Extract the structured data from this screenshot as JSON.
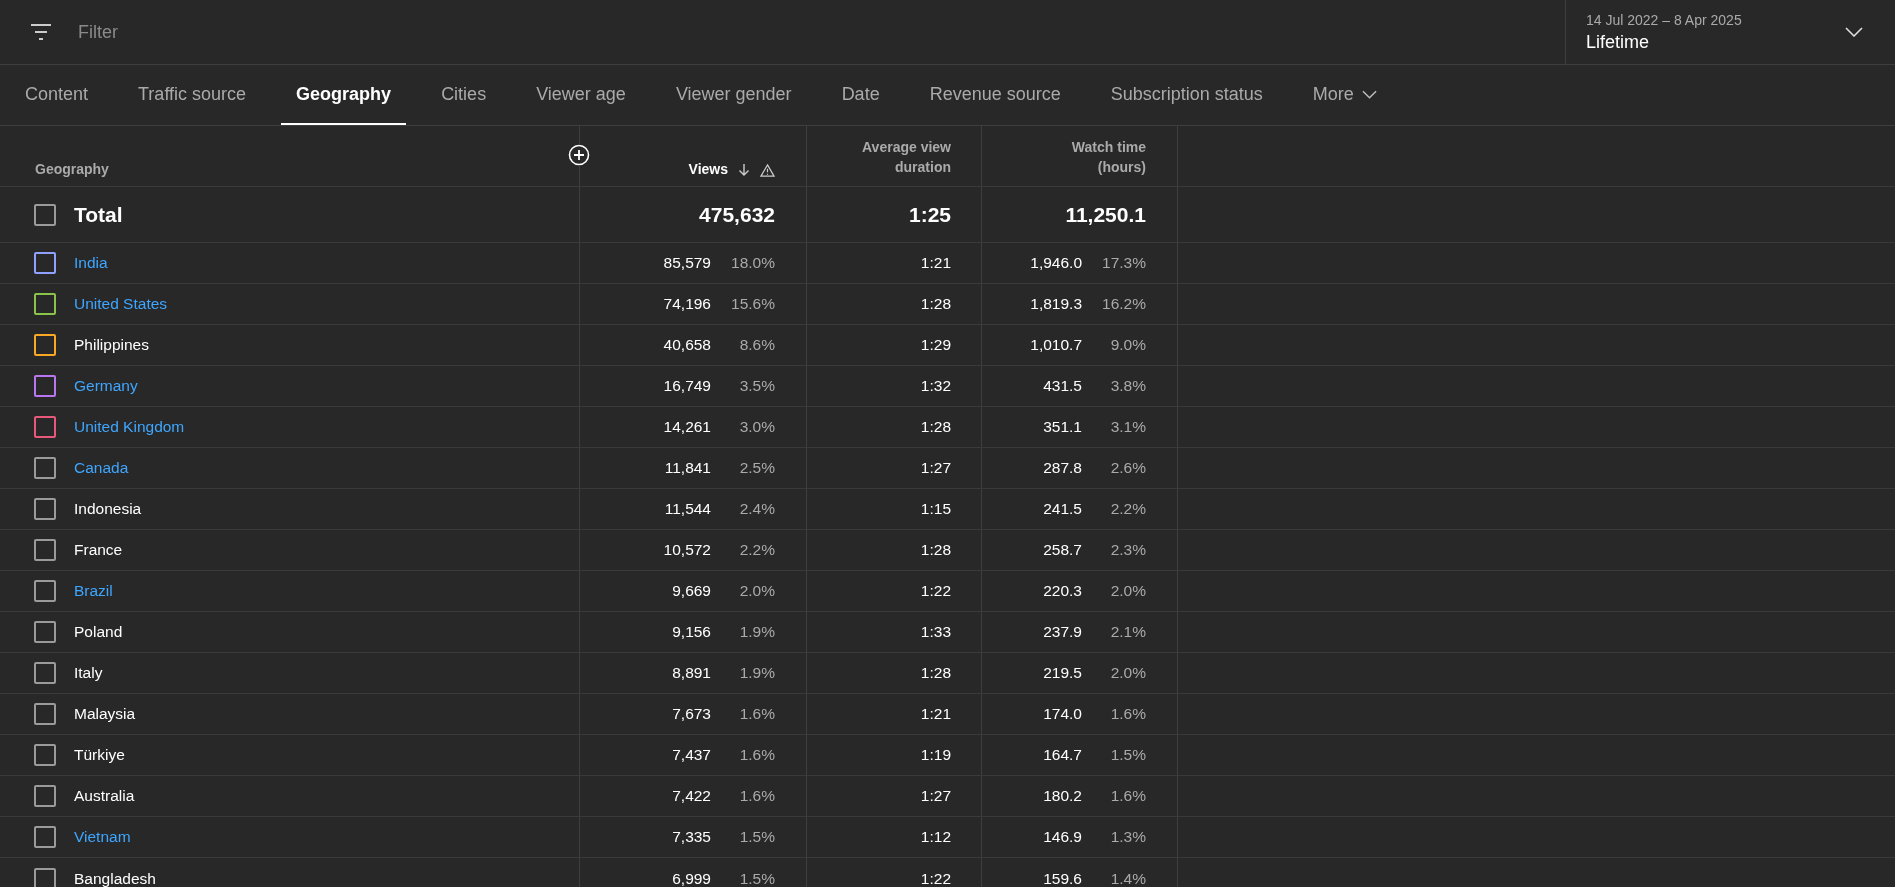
{
  "filter": {
    "placeholder": "Filter"
  },
  "date_range": {
    "range": "14 Jul 2022 – 8 Apr 2025",
    "label": "Lifetime"
  },
  "tabs": [
    {
      "label": "Content",
      "selected": false
    },
    {
      "label": "Traffic source",
      "selected": false
    },
    {
      "label": "Geography",
      "selected": true
    },
    {
      "label": "Cities",
      "selected": false
    },
    {
      "label": "Viewer age",
      "selected": false
    },
    {
      "label": "Viewer gender",
      "selected": false
    },
    {
      "label": "Date",
      "selected": false
    },
    {
      "label": "Revenue source",
      "selected": false
    },
    {
      "label": "Subscription status",
      "selected": false
    },
    {
      "label": "More",
      "selected": false,
      "kind": "menu"
    }
  ],
  "table": {
    "columns": [
      {
        "label": "Geography"
      },
      {
        "label": "Views"
      },
      {
        "label": "Average view duration"
      },
      {
        "label": "Watch time (hours)"
      }
    ],
    "total": {
      "label": "Total",
      "checked": false,
      "views": "475,632",
      "avg_duration": "1:25",
      "watch_time": "11,250.1"
    },
    "rows": [
      {
        "name": "India",
        "link": true,
        "checked": false,
        "color": "#8fa0ff",
        "views": "85,579",
        "views_pct": "18.0%",
        "avg_duration": "1:21",
        "watch_time": "1,946.0",
        "watch_pct": "17.3%"
      },
      {
        "name": "United States",
        "link": true,
        "checked": false,
        "color": "#8bc34a",
        "views": "74,196",
        "views_pct": "15.6%",
        "avg_duration": "1:28",
        "watch_time": "1,819.3",
        "watch_pct": "16.2%"
      },
      {
        "name": "Philippines",
        "link": false,
        "checked": false,
        "color": "#f9a825",
        "views": "40,658",
        "views_pct": "8.6%",
        "avg_duration": "1:29",
        "watch_time": "1,010.7",
        "watch_pct": "9.0%"
      },
      {
        "name": "Germany",
        "link": true,
        "checked": false,
        "color": "#b877f0",
        "views": "16,749",
        "views_pct": "3.5%",
        "avg_duration": "1:32",
        "watch_time": "431.5",
        "watch_pct": "3.8%"
      },
      {
        "name": "United Kingdom",
        "link": true,
        "checked": false,
        "color": "#e8587a",
        "views": "14,261",
        "views_pct": "3.0%",
        "avg_duration": "1:28",
        "watch_time": "351.1",
        "watch_pct": "3.1%"
      },
      {
        "name": "Canada",
        "link": true,
        "checked": false,
        "views": "11,841",
        "views_pct": "2.5%",
        "avg_duration": "1:27",
        "watch_time": "287.8",
        "watch_pct": "2.6%"
      },
      {
        "name": "Indonesia",
        "link": false,
        "checked": false,
        "views": "11,544",
        "views_pct": "2.4%",
        "avg_duration": "1:15",
        "watch_time": "241.5",
        "watch_pct": "2.2%"
      },
      {
        "name": "France",
        "link": false,
        "checked": false,
        "views": "10,572",
        "views_pct": "2.2%",
        "avg_duration": "1:28",
        "watch_time": "258.7",
        "watch_pct": "2.3%"
      },
      {
        "name": "Brazil",
        "link": true,
        "checked": false,
        "views": "9,669",
        "views_pct": "2.0%",
        "avg_duration": "1:22",
        "watch_time": "220.3",
        "watch_pct": "2.0%"
      },
      {
        "name": "Poland",
        "link": false,
        "checked": false,
        "views": "9,156",
        "views_pct": "1.9%",
        "avg_duration": "1:33",
        "watch_time": "237.9",
        "watch_pct": "2.1%"
      },
      {
        "name": "Italy",
        "link": false,
        "checked": false,
        "views": "8,891",
        "views_pct": "1.9%",
        "avg_duration": "1:28",
        "watch_time": "219.5",
        "watch_pct": "2.0%"
      },
      {
        "name": "Malaysia",
        "link": false,
        "checked": false,
        "views": "7,673",
        "views_pct": "1.6%",
        "avg_duration": "1:21",
        "watch_time": "174.0",
        "watch_pct": "1.6%"
      },
      {
        "name": "Türkiye",
        "link": false,
        "checked": false,
        "views": "7,437",
        "views_pct": "1.6%",
        "avg_duration": "1:19",
        "watch_time": "164.7",
        "watch_pct": "1.5%"
      },
      {
        "name": "Australia",
        "link": false,
        "checked": false,
        "views": "7,422",
        "views_pct": "1.6%",
        "avg_duration": "1:27",
        "watch_time": "180.2",
        "watch_pct": "1.6%"
      },
      {
        "name": "Vietnam",
        "link": true,
        "checked": false,
        "views": "7,335",
        "views_pct": "1.5%",
        "avg_duration": "1:12",
        "watch_time": "146.9",
        "watch_pct": "1.3%"
      },
      {
        "name": "Bangladesh",
        "link": false,
        "checked": false,
        "views": "6,999",
        "views_pct": "1.5%",
        "avg_duration": "1:22",
        "watch_time": "159.6",
        "watch_pct": "1.4%"
      }
    ]
  }
}
